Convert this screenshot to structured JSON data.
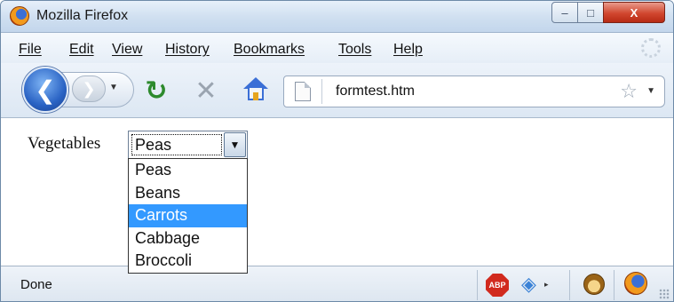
{
  "window": {
    "title": "Mozilla Firefox",
    "controls": {
      "minimize": "–",
      "maximize": "□",
      "close": "X"
    }
  },
  "menubar": {
    "items": [
      "File",
      "Edit",
      "View",
      "History",
      "Bookmarks",
      "Tools",
      "Help"
    ]
  },
  "navbar": {
    "back_icon": "back-arrow-icon",
    "back_glyph": "❮",
    "forward_icon": "forward-arrow-icon",
    "forward_glyph": "❯",
    "history_dropdown": "▼",
    "reload_icon": "reload-icon",
    "reload_glyph": "↻",
    "stop_icon": "stop-icon",
    "stop_glyph": "✕",
    "home_icon": "home-icon",
    "url": "formtest.htm",
    "star_glyph": "☆",
    "url_dropdown": "▼"
  },
  "content": {
    "label": "Vegetables",
    "select": {
      "selected": "Peas",
      "arrow": "▼",
      "options": [
        "Peas",
        "Beans",
        "Carrots",
        "Cabbage",
        "Broccoli"
      ],
      "highlighted": "Carrots"
    }
  },
  "statusbar": {
    "text": "Done",
    "abp_label": "ABP",
    "sync_glyph": "◈",
    "sync_dropdown": "▸"
  },
  "colors": {
    "highlight": "#3399ff",
    "titlebar": "#cfdff0",
    "close_button": "#d1472f"
  }
}
